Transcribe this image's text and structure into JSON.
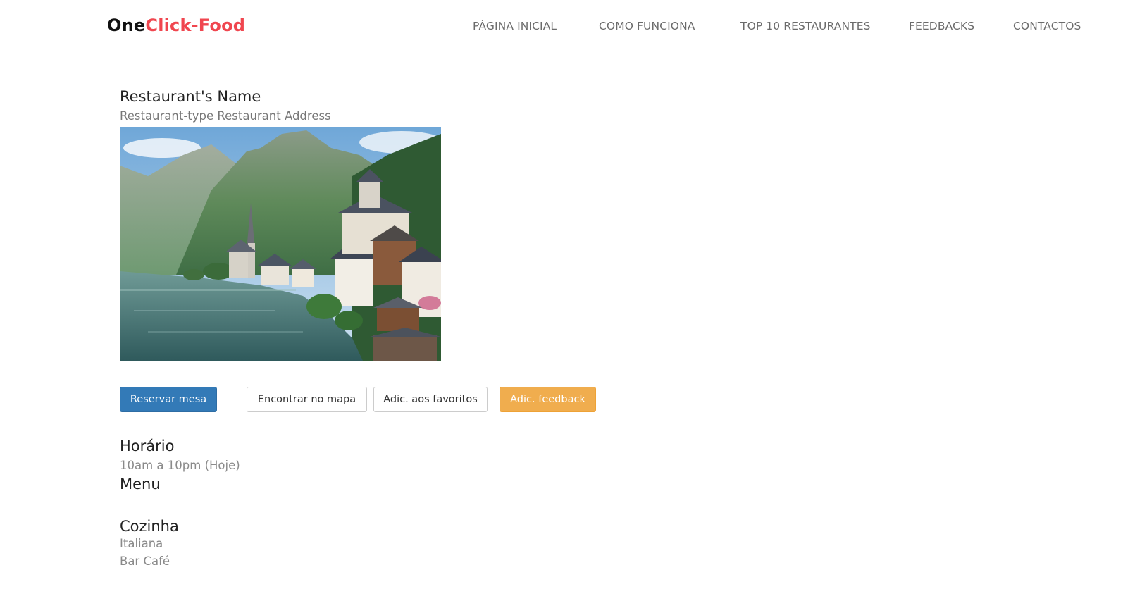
{
  "brand": {
    "part1": "One",
    "part2": "Click-Food",
    "accent": "#f0464f"
  },
  "nav": {
    "items": [
      "PÁGINA INICIAL",
      "COMO FUNCIONA",
      "TOP 10 RESTAURANTES",
      "FEEDBACKS",
      "CONTACTOS"
    ]
  },
  "restaurant": {
    "name": "Restaurant's Name",
    "subtitle": "Restaurant-type Restaurant Address",
    "photo_alt": "lakeside-village-photo"
  },
  "actions": {
    "reserve": "Reservar mesa",
    "map": "Encontrar no mapa",
    "favorites": "Adic. aos favoritos",
    "feedback": "Adic. feedback"
  },
  "colors": {
    "primary": "#337ab7",
    "warning": "#f0ad4e"
  },
  "hours": {
    "title": "Horário",
    "value": "10am a 10pm (Hoje)"
  },
  "menu": {
    "title": "Menu"
  },
  "cuisine": {
    "title": "Cozinha",
    "items": [
      "Italiana",
      "Bar Café"
    ]
  }
}
